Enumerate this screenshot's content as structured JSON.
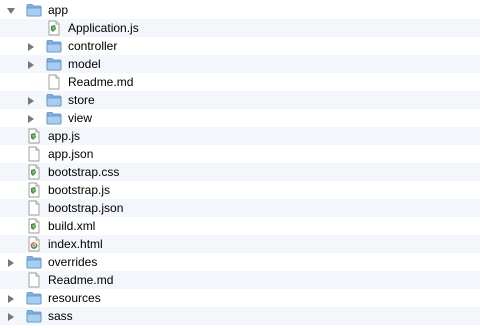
{
  "tree": {
    "rows": [
      {
        "name": "app",
        "type": "folder",
        "expanded": true,
        "level": 0
      },
      {
        "name": "Application.js",
        "type": "js",
        "level": 1
      },
      {
        "name": "controller",
        "type": "folder",
        "expanded": false,
        "level": 1
      },
      {
        "name": "model",
        "type": "folder",
        "expanded": false,
        "level": 1
      },
      {
        "name": "Readme.md",
        "type": "doc",
        "level": 1
      },
      {
        "name": "store",
        "type": "folder",
        "expanded": false,
        "level": 1
      },
      {
        "name": "view",
        "type": "folder",
        "expanded": false,
        "level": 1
      },
      {
        "name": "app.js",
        "type": "js",
        "level": 0
      },
      {
        "name": "app.json",
        "type": "doc",
        "level": 0
      },
      {
        "name": "bootstrap.css",
        "type": "js",
        "level": 0
      },
      {
        "name": "bootstrap.js",
        "type": "js",
        "level": 0
      },
      {
        "name": "bootstrap.json",
        "type": "doc",
        "level": 0
      },
      {
        "name": "build.xml",
        "type": "js",
        "level": 0
      },
      {
        "name": "index.html",
        "type": "html",
        "level": 0
      },
      {
        "name": "overrides",
        "type": "folder",
        "expanded": false,
        "level": 0
      },
      {
        "name": "Readme.md",
        "type": "doc",
        "level": 0
      },
      {
        "name": "resources",
        "type": "folder",
        "expanded": false,
        "level": 0
      },
      {
        "name": "sass",
        "type": "folder",
        "expanded": false,
        "level": 0
      }
    ]
  },
  "icons": {
    "folder": "folder-icon",
    "js": "script-file-icon",
    "doc": "document-icon",
    "html": "html-file-icon"
  },
  "colors": {
    "alternate_row": "#f3f6fa",
    "folder_blue": "#8cbbe8",
    "disclosure": "#777777"
  }
}
